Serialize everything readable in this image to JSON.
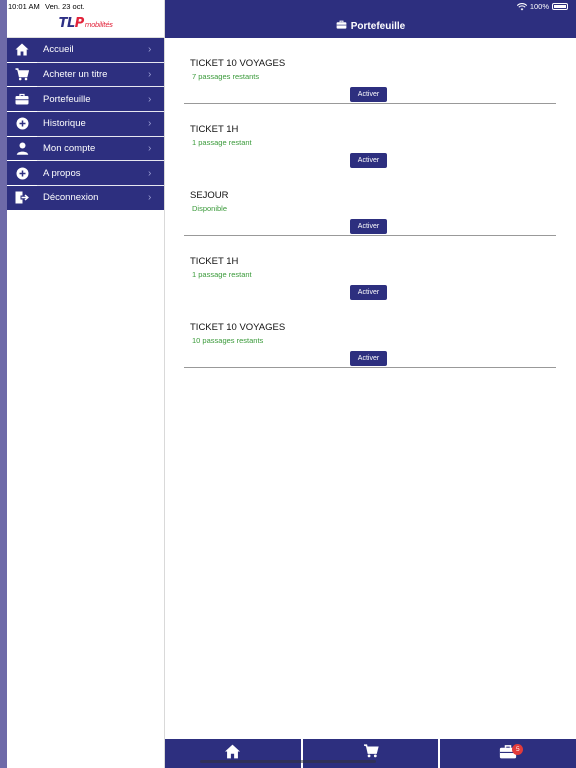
{
  "status_bar": {
    "time": "10:01 AM",
    "date": "Ven. 23 oct.",
    "battery": "100%"
  },
  "logo": {
    "text": "TLP",
    "sub": "mobilités"
  },
  "header": {
    "title": "Portefeuille",
    "icon": "briefcase-icon"
  },
  "menu": [
    {
      "label": "Accueil",
      "icon": "home-icon"
    },
    {
      "label": "Acheter un titre",
      "icon": "cart-icon"
    },
    {
      "label": "Portefeuille",
      "icon": "briefcase-icon"
    },
    {
      "label": "Historique",
      "icon": "plus-circle-icon"
    },
    {
      "label": "Mon compte",
      "icon": "person-icon"
    },
    {
      "label": "A propos",
      "icon": "plus-circle-icon"
    },
    {
      "label": "Déconnexion",
      "icon": "logout-icon"
    }
  ],
  "tickets": [
    {
      "title": "TICKET 10 VOYAGES",
      "status": "7 passages restants",
      "button": "Activer"
    },
    {
      "title": "TICKET 1H",
      "status": "1 passage restant",
      "button": "Activer"
    },
    {
      "title": "SEJOUR",
      "status": "Disponible",
      "button": "Activer"
    },
    {
      "title": "TICKET 1H",
      "status": "1 passage restant",
      "button": "Activer"
    },
    {
      "title": "TICKET 10 VOYAGES",
      "status": "10 passages restants",
      "button": "Activer"
    }
  ],
  "tabbar": {
    "tabs": [
      {
        "icon": "home-icon"
      },
      {
        "icon": "cart-icon"
      },
      {
        "icon": "briefcase-icon",
        "badge": "5"
      }
    ]
  },
  "colors": {
    "brand": "#2d2f7f",
    "status_green": "#3a9a3a",
    "badge_red": "#e23a3a"
  }
}
